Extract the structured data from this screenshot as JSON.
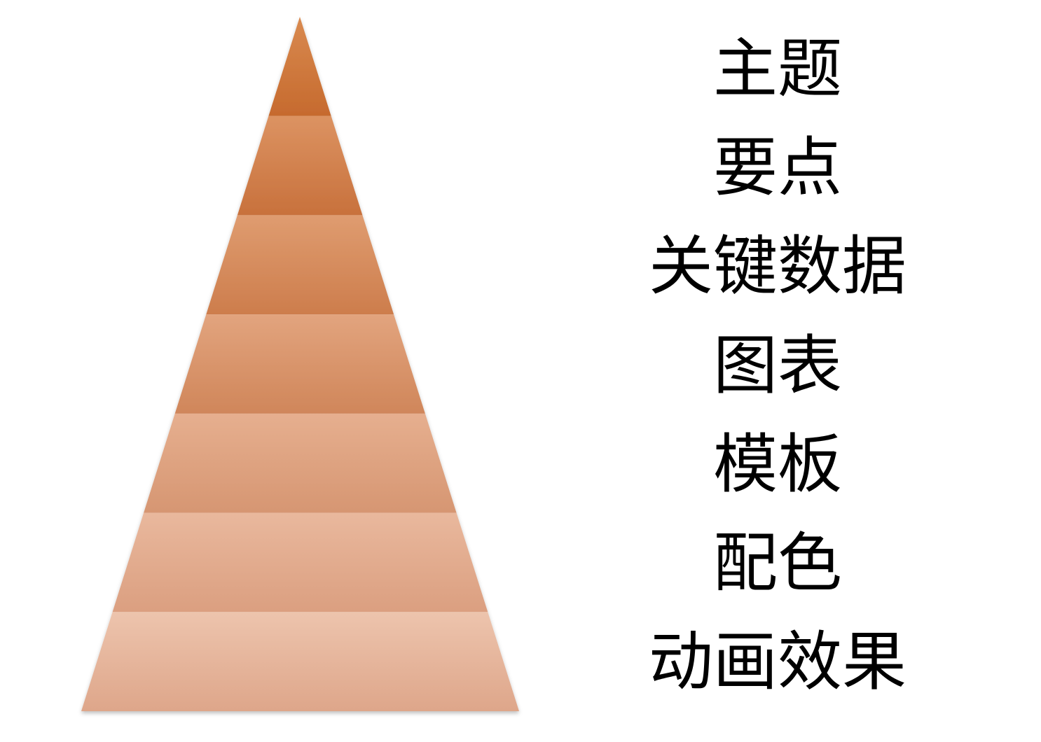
{
  "pyramid": {
    "levels": [
      {
        "label": "主题",
        "color_top": "#d98a50",
        "color_bottom": "#c66a2e"
      },
      {
        "label": "要点",
        "color_top": "#dc9362",
        "color_bottom": "#c8713c"
      },
      {
        "label": "关键数据",
        "color_top": "#df9c70",
        "color_bottom": "#cd7d4c"
      },
      {
        "label": "图表",
        "color_top": "#e2a47e",
        "color_bottom": "#d0865a"
      },
      {
        "label": "模板",
        "color_top": "#e6af8f",
        "color_bottom": "#d69672"
      },
      {
        "label": "配色",
        "color_top": "#e9b89d",
        "color_bottom": "#db9f80"
      },
      {
        "label": "动画效果",
        "color_top": "#edc4ad",
        "color_bottom": "#dea68a"
      }
    ]
  }
}
